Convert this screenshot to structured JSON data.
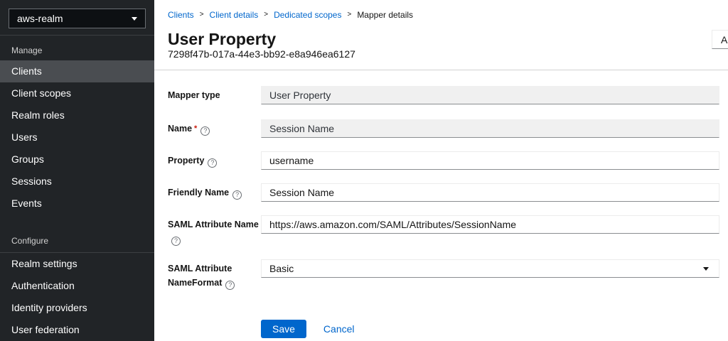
{
  "colors": {
    "accent": "#0066cc",
    "danger": "#c9190b",
    "sidebar_bg": "#212427",
    "sidebar_selected": "#4a4d51",
    "divider": "#d2d2d2",
    "input_disabled_bg": "#f0f0f0",
    "input_border_bottom": "#8a8d90"
  },
  "sidebar": {
    "realm_selector": {
      "value": "aws-realm",
      "icon": "caret-down-icon"
    },
    "selected_item": "Clients",
    "groups": [
      {
        "title": "Manage",
        "items": [
          "Clients",
          "Client scopes",
          "Realm roles",
          "Users",
          "Groups",
          "Sessions",
          "Events"
        ]
      },
      {
        "title": "Configure",
        "items": [
          "Realm settings",
          "Authentication",
          "Identity providers",
          "User federation"
        ]
      }
    ]
  },
  "breadcrumb": {
    "links": [
      "Clients",
      "Client details",
      "Dedicated scopes"
    ],
    "current": "Mapper details",
    "separator": ">"
  },
  "header": {
    "title": "User Property",
    "subtitle": "7298f47b-017a-44e3-bb92-e8a946ea6127",
    "action_button": "Ac"
  },
  "form": {
    "fields": [
      {
        "label": "Mapper type",
        "value": "User Property",
        "state": "readonly",
        "required": false,
        "help": false
      },
      {
        "label": "Name",
        "value": "Session Name",
        "state": "readonly",
        "required": true,
        "help": true
      },
      {
        "label": "Property",
        "value": "username",
        "state": "editable",
        "required": false,
        "help": true
      },
      {
        "label": "Friendly Name",
        "value": "Session Name",
        "state": "editable",
        "required": false,
        "help": true
      },
      {
        "label": "SAML Attribute Name",
        "value": "https://aws.amazon.com/SAML/Attributes/SessionName",
        "state": "editable",
        "required": false,
        "help": true
      },
      {
        "label": "SAML Attribute",
        "label2": "NameFormat",
        "value": "Basic",
        "state": "select",
        "required": false,
        "help": true
      }
    ],
    "save_label": "Save",
    "cancel_label": "Cancel"
  }
}
